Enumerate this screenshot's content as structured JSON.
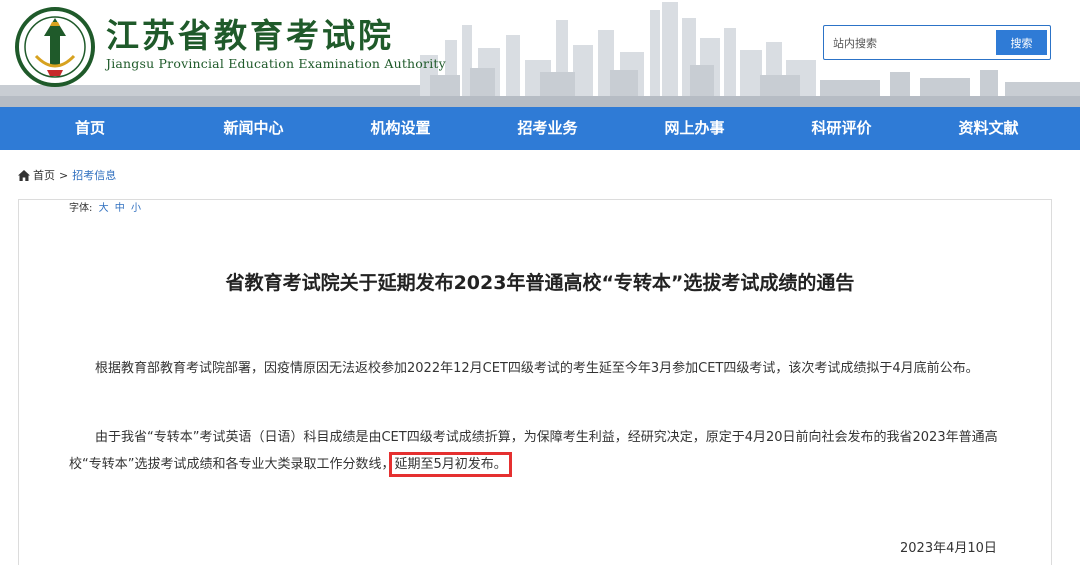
{
  "header": {
    "title": "江苏省教育考试院",
    "subtitle": "Jiangsu Provincial Education Examination Authority",
    "logo_icon": "jseea-emblem-icon",
    "brand_color": "#1f5a2a"
  },
  "search": {
    "placeholder": "站内搜索",
    "button_label": "搜索",
    "accent_color": "#2f7bd6"
  },
  "nav": {
    "items": [
      {
        "label": "首页"
      },
      {
        "label": "新闻中心"
      },
      {
        "label": "机构设置"
      },
      {
        "label": "招考业务"
      },
      {
        "label": "网上办事"
      },
      {
        "label": "科研评价"
      },
      {
        "label": "资料文献"
      }
    ],
    "background_color": "#2f7bd6"
  },
  "breadcrumb": {
    "home_icon": "home-icon",
    "home_label": "首页",
    "separator": ">",
    "current_label": "招考信息"
  },
  "font_size": {
    "label": "字体:",
    "options": [
      "大",
      "中",
      "小"
    ]
  },
  "article": {
    "title": "省教育考试院关于延期发布2023年普通高校“专转本”选拔考试成绩的通告",
    "paragraph1": "根据教育部教育考试院部署，因疫情原因无法返校参加2022年12月CET四级考试的考生延至今年3月参加CET四级考试，该次考试成绩拟于4月底前公布。",
    "paragraph2_before": "由于我省“专转本”考试英语（日语）科目成绩是由CET四级考试成绩折算，为保障考生利益，经研究决定，原定于4月20日前向社会发布的我省2023年普通高校“专转本”选拔考试成绩和各专业大类录取工作分数线，",
    "paragraph2_highlight": "延期至5月初发布。",
    "highlight_color": "#e53030",
    "date": "2023年4月10日"
  }
}
